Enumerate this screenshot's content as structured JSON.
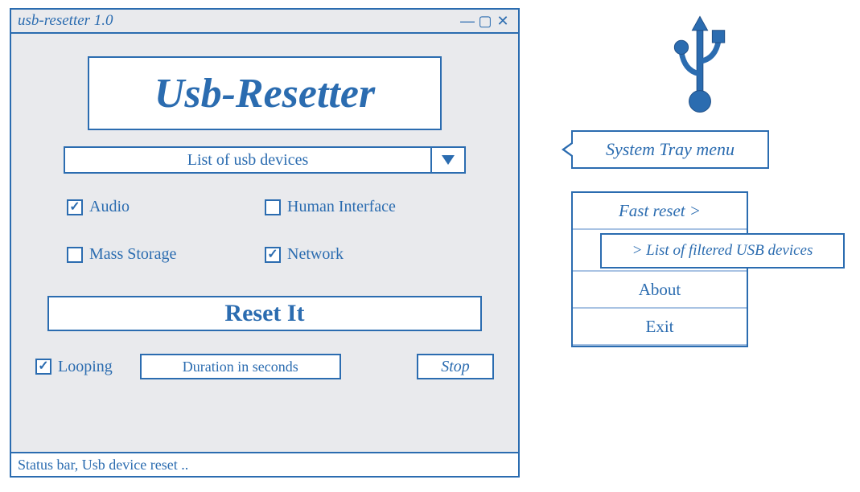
{
  "window": {
    "title": "usb-resetter 1.0",
    "banner": "Usb-Resetter",
    "dropdown": {
      "label": "List of usb devices"
    },
    "checks": {
      "audio": {
        "label": "Audio",
        "checked": true
      },
      "human": {
        "label": "Human Interface",
        "checked": false
      },
      "mass": {
        "label": "Mass Storage",
        "checked": false
      },
      "network": {
        "label": "Network",
        "checked": true
      }
    },
    "reset_label": "Reset It",
    "looping": {
      "label": "Looping",
      "checked": true
    },
    "duration_placeholder": "Duration in seconds",
    "stop_label": "Stop",
    "status": "Status bar, Usb device reset .."
  },
  "tray": {
    "tooltip": "System Tray menu",
    "items": {
      "fast": "Fast reset >",
      "about": "About",
      "exit": "Exit"
    },
    "submenu": "> List of filtered USB devices"
  }
}
